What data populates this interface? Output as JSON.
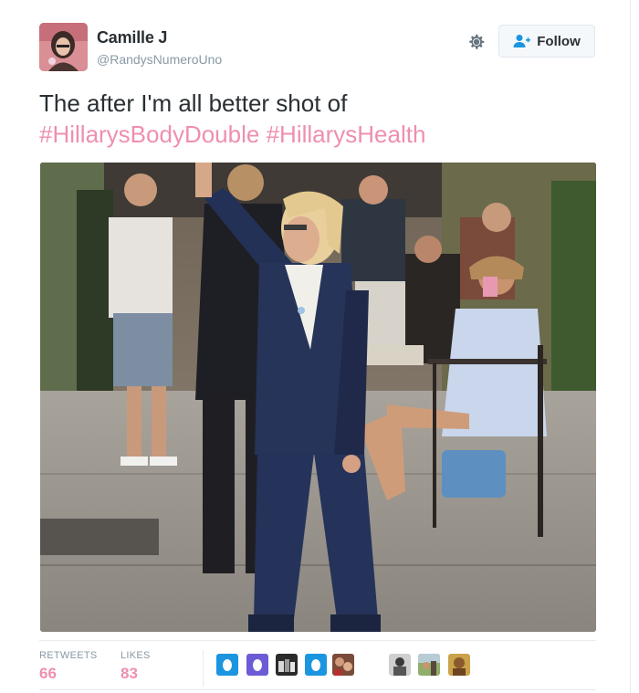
{
  "user": {
    "name": "Camille J",
    "handle": "@RandysNumeroUno"
  },
  "follow_label": "Follow",
  "tweet": {
    "text": "The after I'm all better shot of",
    "hashtags": [
      "#HillarysBodyDouble",
      "#HillarysHealth"
    ]
  },
  "stats": {
    "retweets_label": "RETWEETS",
    "retweets": "66",
    "likes_label": "LIKES",
    "likes": "83"
  },
  "colors": {
    "hashtag": "#ee8fb0",
    "count": "#ee8fb0",
    "egg_blue": "#1b95e0",
    "egg_purple": "#6b5cd6",
    "secondary_text": "#8899a6"
  },
  "icons": {
    "settings": "gear-icon",
    "follow": "add-user-icon"
  }
}
